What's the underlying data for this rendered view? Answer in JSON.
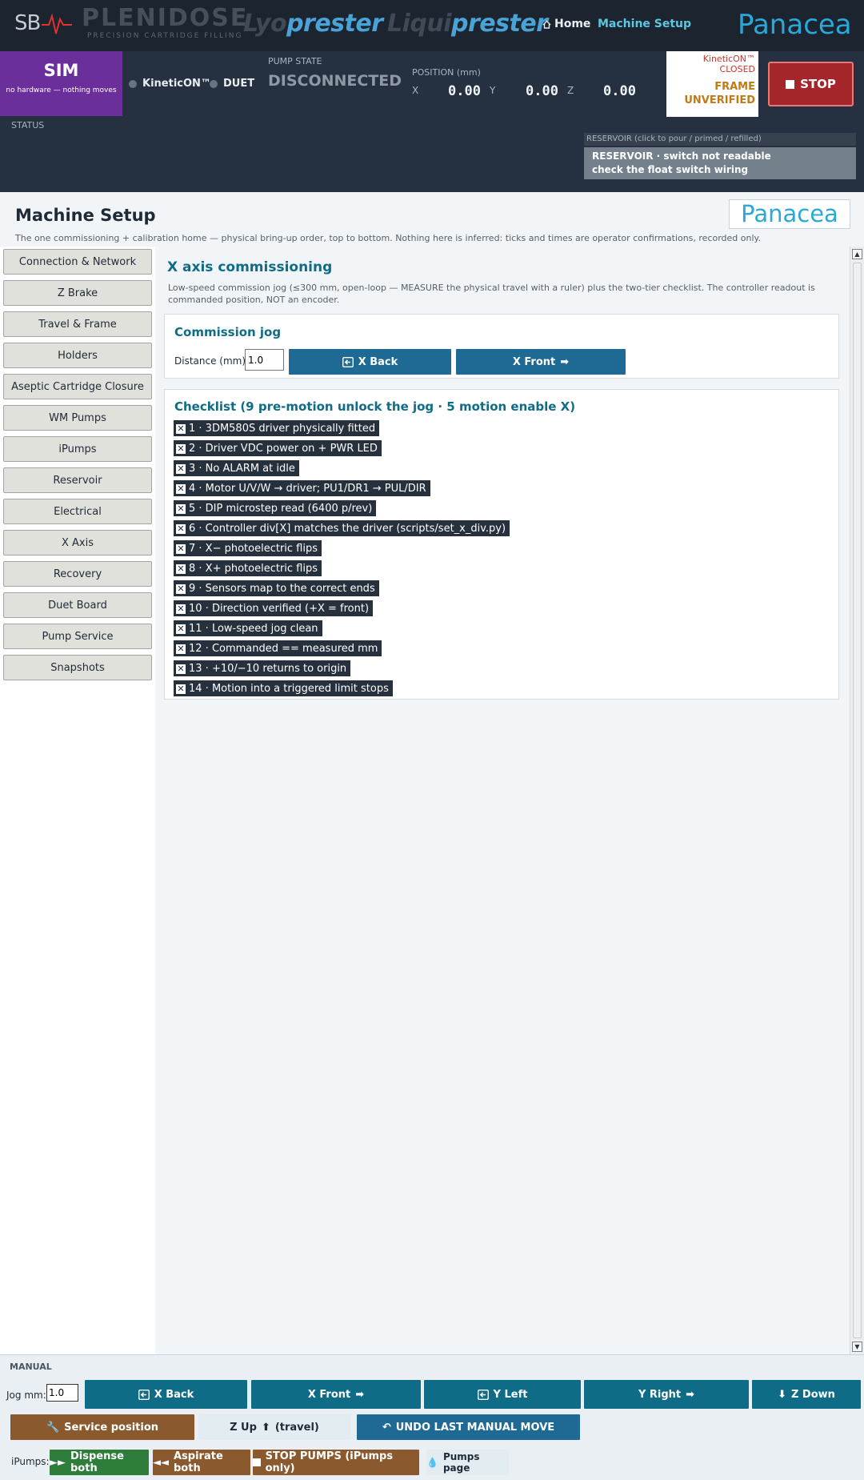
{
  "nav": {
    "sb_logo": "SB",
    "brand1": "PLENIDOSE",
    "brand1_tagline": "PRECISION CARTRIDGE FILLING",
    "brand2_a": "Lyo",
    "brand2_b": "prester",
    "brand3_a": "Liqui",
    "brand3_b": "prester",
    "home": "Home",
    "machine_setup": "Machine Setup",
    "panacea": "Panacea"
  },
  "status": {
    "sim_title": "SIM",
    "sim_sub": "no hardware — nothing moves",
    "status_label": "STATUS",
    "kinetic": "KineticON™",
    "duet": "DUET",
    "pump_state_label": "PUMP STATE",
    "pump_state": "DISCONNECTED",
    "position_label": "POSITION (mm)",
    "x_label": "X",
    "x_val": "0.00",
    "y_label": "Y",
    "y_val": "0.00",
    "z_label": "Z",
    "z_val": "0.00",
    "kin_closed": "KineticON™ CLOSED",
    "frame_line1": "FRAME",
    "frame_line2": "UNVERIFIED",
    "stop": "STOP",
    "reservoir_label": "RESERVOIR  (click to pour / primed / refilled)",
    "reservoir_line1": "RESERVOIR · switch not readable",
    "reservoir_line2": "check the float switch wiring",
    "colors": {
      "sim": "#6b2f9b",
      "stop": "#a5262a",
      "accent": "#0f6c86"
    }
  },
  "page": {
    "title": "Machine Setup",
    "subtitle": "The one commissioning + calibration home — physical bring-up order, top to bottom. Nothing here is inferred: ticks and times are operator confirmations, recorded only.",
    "panacea": "Panacea"
  },
  "sidebar": {
    "items": [
      {
        "label": "Connection & Network"
      },
      {
        "label": "Z Brake"
      },
      {
        "label": "Travel & Frame"
      },
      {
        "label": "Holders"
      },
      {
        "label": "Aseptic Cartridge Closure"
      },
      {
        "label": "WM Pumps"
      },
      {
        "label": "iPumps"
      },
      {
        "label": "Reservoir"
      },
      {
        "label": "Electrical"
      },
      {
        "label": "X Axis"
      },
      {
        "label": "Recovery"
      },
      {
        "label": "Duet Board"
      },
      {
        "label": "Pump Service"
      },
      {
        "label": "Snapshots"
      }
    ]
  },
  "main": {
    "title": "X axis commissioning",
    "desc": "Low-speed commission jog (≤300 mm, open-loop — MEASURE the physical travel with a ruler) plus the two-tier checklist. The controller readout is commanded position, NOT an encoder.",
    "jog_card": {
      "heading": "Commission jog",
      "distance_label": "Distance (mm):",
      "distance_value": "1.0",
      "back": "X Back",
      "front": "X Front"
    },
    "checklist": {
      "heading": "Checklist (9 pre-motion unlock the jog · 5 motion enable X)",
      "items": [
        "1 · 3DM580S driver physically fitted",
        "2 · Driver VDC power on + PWR LED",
        "3 · No ALARM at idle",
        "4 · Motor U/V/W → driver; PU1/DR1 → PUL/DIR",
        "5 · DIP microstep read (6400 p/rev)",
        "6 · Controller div[X] matches the driver (scripts/set_x_div.py)",
        "7 · X− photoelectric flips",
        "8 · X+ photoelectric flips",
        "9 · Sensors map to the correct ends",
        "10 · Direction verified (+X = front)",
        "11 · Low-speed jog clean",
        "12 · Commanded == measured mm",
        "13 · +10/−10 returns to origin",
        "14 · Motion into a triggered limit stops"
      ]
    }
  },
  "manual": {
    "label": "MANUAL",
    "jog_label": "Jog mm:",
    "jog_value": "1.0",
    "x_back": "X Back",
    "x_front": "X Front",
    "y_left": "Y Left",
    "y_right": "Y Right",
    "z_down": "Z Down",
    "service": "Service position",
    "z_up": "Z Up",
    "z_up_note": "(travel)",
    "undo": "UNDO LAST MANUAL MOVE",
    "ipumps_label": "iPumps:",
    "dispense": "Dispense both",
    "aspirate": "Aspirate both",
    "stop_pumps": "STOP PUMPS (iPumps only)",
    "pumps_page": "Pumps page"
  }
}
